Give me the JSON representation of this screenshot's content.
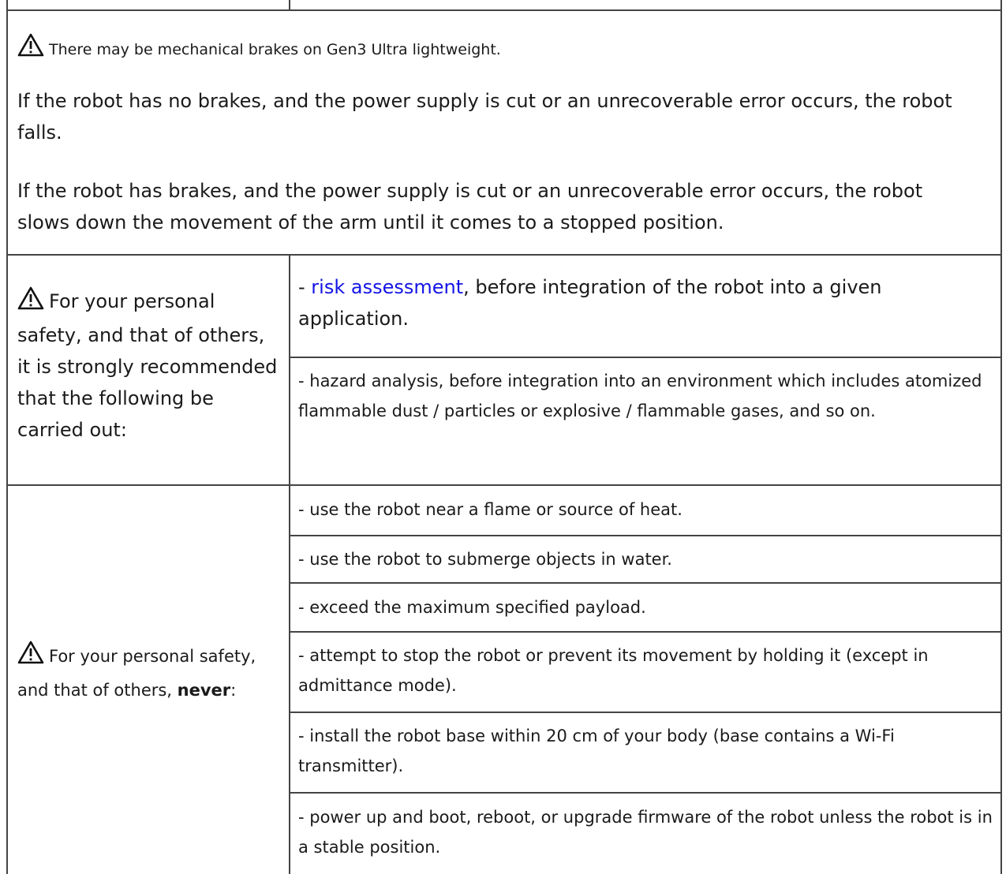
{
  "note": {
    "text": "There may be mechanical brakes on Gen3 Ultra lightweight.",
    "icon": "warning-triangle-icon"
  },
  "paragraphs": [
    "If the robot has no brakes, and the power supply is cut or an unrecoverable error occurs, the robot falls.",
    "If the robot has brakes, and the power supply is cut or an unrecoverable error occurs, the robot slows down the movement of the arm until it comes to a stopped position."
  ],
  "recommend": {
    "label": "For your personal safety, and that of others, it is strongly recommended that the following be carried out:",
    "items": [
      {
        "prefix": "- ",
        "link": "risk assessment",
        "rest": ", before integration of the robot into a given application."
      },
      {
        "text": "- hazard analysis, before integration into an environment which includes atomized flammable dust / particles or explosive / flammable gases, and so on."
      }
    ]
  },
  "never": {
    "label_prefix": "For your personal safety, and that of others, ",
    "label_bold": "never",
    "label_suffix": ":",
    "items": [
      "- use the robot near a flame or source of heat.",
      "- use the robot to submerge objects in water.",
      "- exceed the maximum specified payload.",
      "- attempt to stop the robot or prevent its movement by holding it (except in admittance mode).",
      "- install the robot base within 20 cm of your body (base contains a Wi-Fi transmitter).",
      "- power up and boot, reboot, or upgrade firmware of the robot unless the robot is in a stable position."
    ]
  },
  "colors": {
    "link": "#1414e6",
    "border": "#444444",
    "text": "#1a1a1a"
  }
}
